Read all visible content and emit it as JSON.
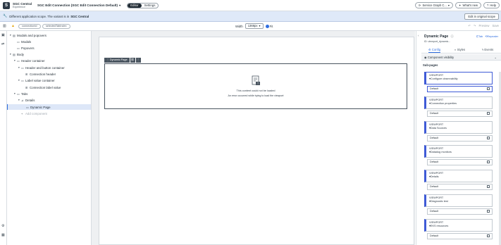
{
  "app": {
    "brand_title": "SGC Central",
    "brand_subtitle": "Experience",
    "page_selector": "SGC Edit Connection (SGC Edit Connection Default)",
    "mode_tabs": [
      "Editor",
      "Settings"
    ],
    "active_mode": "Editor",
    "right_actions": {
      "service_graph": "Service Graph C...",
      "whats_new": "What's new",
      "help": "Help"
    }
  },
  "banner": {
    "message": "Different application scope. The variant is in",
    "scope": "SGC Central",
    "button": "Edit in original scope"
  },
  "toolbar": {
    "crumbs": [
      "connectionId",
      "selectedTabIndex"
    ],
    "width_label": "Width",
    "width_value": "1366px",
    "fit_label": "Fit",
    "preview_label": "Preview",
    "save_label": "Save"
  },
  "tree": {
    "nodes": [
      {
        "label": "Modals and popovers",
        "level": 0,
        "twisty": "▾",
        "icon": "▤"
      },
      {
        "label": "Modals",
        "level": 1,
        "twisty": "",
        "icon": "▭"
      },
      {
        "label": "Popovers",
        "level": 1,
        "twisty": "",
        "icon": "▭"
      },
      {
        "label": "Body",
        "level": 0,
        "twisty": "▾",
        "icon": "▤"
      },
      {
        "label": "Header container",
        "level": 1,
        "twisty": "▾",
        "icon": "▭"
      },
      {
        "label": "Header and button container",
        "level": 2,
        "twisty": "▾",
        "icon": "▭"
      },
      {
        "label": "Connection header",
        "level": 3,
        "twisty": "",
        "icon": "⊞"
      },
      {
        "label": "Label value container",
        "level": 2,
        "twisty": "▾",
        "icon": "▭"
      },
      {
        "label": "Connection label value",
        "level": 3,
        "twisty": "",
        "icon": "⊞"
      },
      {
        "label": "Tabs",
        "level": 1,
        "twisty": "▾",
        "icon": "▭"
      },
      {
        "label": "Details",
        "level": 2,
        "twisty": "▾",
        "icon": "⊿"
      },
      {
        "label": "Dynamic Page",
        "level": 3,
        "twisty": "",
        "icon": "▭"
      },
      {
        "label": "Add component",
        "level": 2,
        "twisty": "",
        "icon": "+"
      }
    ]
  },
  "canvas": {
    "component_tag": "Dynamic Page",
    "error_title": "This content could not be loaded",
    "error_detail": "An error occurred while trying to load the viewport"
  },
  "right_panel": {
    "title": "Dynamic Page",
    "tab_link": "Tab",
    "repeater_link": "Repeater",
    "id_text": "ID: viewport_dynamic...",
    "tabs": [
      "Config",
      "Styles",
      "Events"
    ],
    "active_tab": "Config",
    "section": "Component visibility",
    "subpages_heading": "Sub-pages",
    "subpages": [
      {
        "kind": "VIEWPORT",
        "name": "Configure observability",
        "variant": "Default"
      },
      {
        "kind": "VIEWPORT",
        "name": "Connection properties",
        "variant": "Default"
      },
      {
        "kind": "VIEWPORT",
        "name": "Data Sources",
        "variant": "Default"
      },
      {
        "kind": "VIEWPORT",
        "name": "Datadog monitors",
        "variant": "Default"
      },
      {
        "kind": "VIEWPORT",
        "name": "Details",
        "variant": "Default"
      },
      {
        "kind": "VIEWPORT",
        "name": "Diagnostic test",
        "variant": "Default"
      },
      {
        "kind": "VIEWPORT",
        "name": "EKS resources",
        "variant": "Default"
      }
    ]
  },
  "colors": {
    "accent": "#2f6ee0",
    "viewport_bar": "#3f5bd6",
    "banner_bg": "#dfe9f8",
    "warning": "#e3a200"
  }
}
